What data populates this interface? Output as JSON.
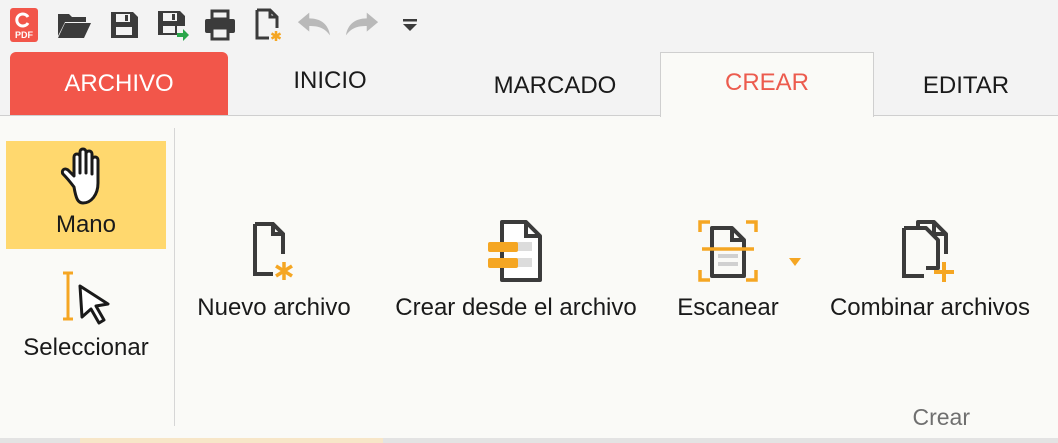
{
  "colors": {
    "accent_red": "#f2564a",
    "active_tab_text": "#ec5b4e",
    "selected_tool_bg": "#ffd86e",
    "icon_orange": "#f5a623",
    "icon_dark": "#3b3b3b"
  },
  "quick_access": [
    {
      "name": "app-logo",
      "icon": "pdf-app-logo-icon",
      "logo_text": "PDF"
    },
    {
      "name": "open",
      "icon": "folder-open-icon"
    },
    {
      "name": "save",
      "icon": "save-icon"
    },
    {
      "name": "save-as",
      "icon": "save-as-icon"
    },
    {
      "name": "print",
      "icon": "printer-icon"
    },
    {
      "name": "new",
      "icon": "new-file-icon"
    },
    {
      "name": "undo",
      "icon": "undo-icon"
    },
    {
      "name": "redo",
      "icon": "redo-icon"
    },
    {
      "name": "customize",
      "icon": "customize-dropdown-icon"
    }
  ],
  "tabs": [
    {
      "label": "ARCHIVO"
    },
    {
      "label": "INICIO"
    },
    {
      "label": "MARCADO"
    },
    {
      "label": "CREAR",
      "active": true
    },
    {
      "label": "EDITAR"
    }
  ],
  "tools": {
    "hand": {
      "label": "Mano",
      "icon": "hand-icon",
      "selected": true
    },
    "select": {
      "label": "Seleccionar",
      "icon": "select-cursor-icon"
    }
  },
  "create_group": {
    "items": [
      {
        "label": "Nuevo archivo",
        "icon": "new-file-icon"
      },
      {
        "label": "Crear desde el archivo",
        "icon": "create-from-file-icon"
      },
      {
        "label": "Escanear",
        "icon": "scan-icon",
        "has_dropdown": true
      },
      {
        "label": "Combinar archivos",
        "icon": "combine-files-icon"
      }
    ],
    "group_label": "Crear"
  }
}
